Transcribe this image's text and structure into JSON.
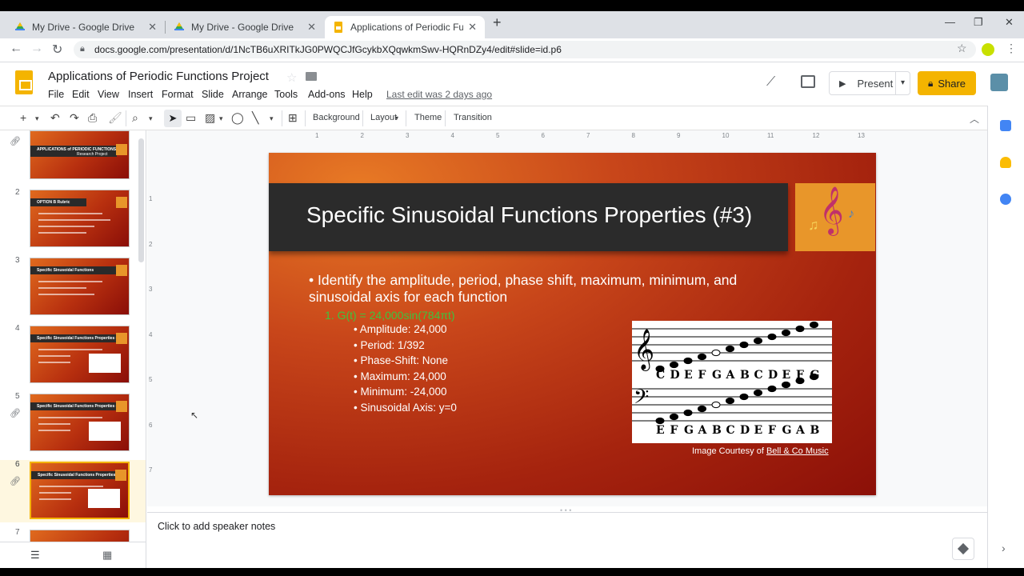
{
  "browser": {
    "tabs": [
      {
        "title": "My Drive - Google Drive",
        "close": "✕"
      },
      {
        "title": "My Drive - Google Drive",
        "close": "✕"
      },
      {
        "title": "Applications of Periodic Functions",
        "close": "✕"
      }
    ],
    "new_tab": "+",
    "url": "docs.google.com/presentation/d/1NcTB6uXRITkJG0PWQCJfGcykbXQqwkmSwv-HQRnDZy4/edit#slide=id.p6"
  },
  "doc": {
    "title": "Applications of Periodic Functions Project",
    "menu": [
      "File",
      "Edit",
      "View",
      "Insert",
      "Format",
      "Slide",
      "Arrange",
      "Tools",
      "Add-ons",
      "Help"
    ],
    "last_edit": "Last edit was 2 days ago",
    "present_label": "Present",
    "share_label": "Share"
  },
  "toolbar": {
    "background": "Background",
    "layout": "Layout",
    "theme": "Theme",
    "transition": "Transition"
  },
  "filmstrip": {
    "numbers": [
      "2",
      "3",
      "4",
      "5",
      "6",
      "7"
    ],
    "selected": "6",
    "thumb_titles": {
      "t1a": "APPLICATIONS of PERIODIC FUNCTIONS",
      "t1b": "Research Project",
      "t2": "OPTION B Rubric",
      "t3": "Specific Sinusoidal Functions",
      "t4": "Specific Sinusoidal Functions Properties (#1)",
      "t5": "Specific Sinusoidal Functions Properties (#2)",
      "t6": "Specific Sinusoidal Functions Properties (#3)"
    }
  },
  "ruler": {
    "h": [
      "1",
      "2",
      "3",
      "4",
      "5",
      "6",
      "7",
      "8",
      "9",
      "10",
      "11",
      "12",
      "13"
    ],
    "v": [
      "1",
      "2",
      "3",
      "4",
      "5",
      "6",
      "7"
    ]
  },
  "slide": {
    "title": "Specific Sinusoidal Functions Properties (#3)",
    "bullet": "Identify the amplitude, period, phase shift, maximum, minimum, and sinusoidal axis for each function",
    "function": "1.   G(t) = 24,000sin(784πt)",
    "properties": [
      "Amplitude: 24,000",
      "Period: 1/392",
      "Phase-Shift: None",
      "Maximum: 24,000",
      "Minimum: -24,000",
      "Sinusoidal Axis: y=0"
    ],
    "treble_notes": [
      "C",
      "D",
      "E",
      "F",
      "G",
      "A",
      "B",
      "C",
      "D",
      "E",
      "F",
      "G"
    ],
    "bass_notes": [
      "E",
      "F",
      "G",
      "A",
      "B",
      "C",
      "D",
      "E",
      "F",
      "G",
      "A",
      "B"
    ],
    "caption_prefix": "Image Courtesy of ",
    "caption_link": "Bell & Co Music"
  },
  "notes": {
    "placeholder": "Click to add speaker notes"
  },
  "colors": {
    "accent": "#f4b400",
    "function_green": "#3ec43e",
    "title_bar": "#2b2b2b"
  }
}
